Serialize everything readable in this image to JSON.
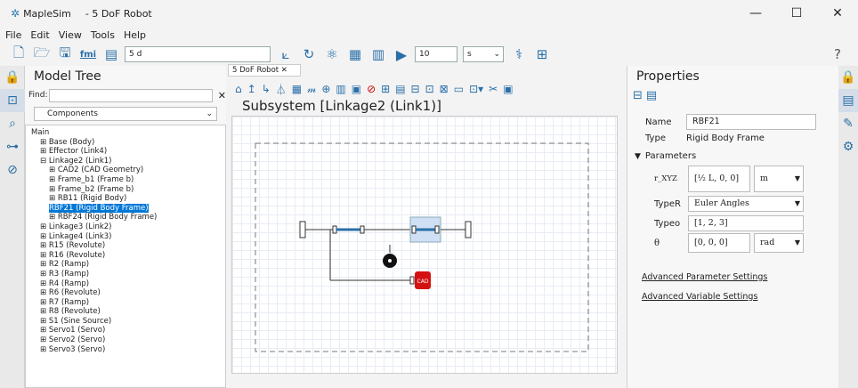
{
  "app": {
    "name": "MapleSim",
    "document": "- 5 DoF Robot"
  },
  "window_controls": {
    "minimize": "—",
    "maximize": "☐",
    "close": "✕"
  },
  "menu": [
    "File",
    "Edit",
    "View",
    "Tools",
    "Help"
  ],
  "toolbar": {
    "search_value": "5 d",
    "sim_time": "10",
    "time_unit": "s"
  },
  "model_tree": {
    "title": "Model Tree",
    "find_label": "Find:",
    "filter": "Components",
    "items": [
      {
        "label": "Main",
        "indent": 0
      },
      {
        "label": "⊞ Base (Body)",
        "indent": 1
      },
      {
        "label": "⊞ Effector (Link4)",
        "indent": 1
      },
      {
        "label": "⊟ Linkage2 (Link1)",
        "indent": 1
      },
      {
        "label": "⊞ CAD2 (CAD Geometry)",
        "indent": 2
      },
      {
        "label": "⊞ Frame_b1 (Frame b)",
        "indent": 2
      },
      {
        "label": "⊞ Frame_b2 (Frame b)",
        "indent": 2
      },
      {
        "label": "⊞ RB11 (Rigid Body)",
        "indent": 2
      },
      {
        "label": "RBF21 (Rigid Body Frame)",
        "indent": 2,
        "selected": true
      },
      {
        "label": "⊞ RBF24 (Rigid Body Frame)",
        "indent": 2
      },
      {
        "label": "⊞ Linkage3 (Link2)",
        "indent": 1
      },
      {
        "label": "⊞ Linkage4 (Link3)",
        "indent": 1
      },
      {
        "label": "⊞ R15 (Revolute)",
        "indent": 1
      },
      {
        "label": "⊞ R16 (Revolute)",
        "indent": 1
      },
      {
        "label": "⊞ R2 (Ramp)",
        "indent": 1
      },
      {
        "label": "⊞ R3 (Ramp)",
        "indent": 1
      },
      {
        "label": "⊞ R4 (Ramp)",
        "indent": 1
      },
      {
        "label": "⊞ R6 (Revolute)",
        "indent": 1
      },
      {
        "label": "⊞ R7 (Ramp)",
        "indent": 1
      },
      {
        "label": "⊞ R8 (Revolute)",
        "indent": 1
      },
      {
        "label": "⊞ S1 (Sine Source)",
        "indent": 1
      },
      {
        "label": "⊞ Servo1 (Servo)",
        "indent": 1
      },
      {
        "label": "⊞ Servo2 (Servo)",
        "indent": 1
      },
      {
        "label": "⊞ Servo3 (Servo)",
        "indent": 1
      }
    ]
  },
  "editor": {
    "tab": "5 DoF Robot ✕",
    "subsystem_title": "Subsystem [Linkage2 (Link1)]",
    "cad_label": "CAD"
  },
  "properties": {
    "title": "Properties",
    "name_label": "Name",
    "name_value": "RBF21",
    "type_label": "Type",
    "type_value": "Rigid Body Frame",
    "parameters_label": "Parameters",
    "rxyz_label": "r_XYZ",
    "rxyz_value": "[½ L, 0, 0]",
    "rxyz_unit": "m",
    "typeR_label": "TypeR",
    "typeR_value": "Euler Angles",
    "typeo_label": "Typeo",
    "typeo_value": "[1, 2, 3]",
    "theta_label": "θ",
    "theta_value": "[0, 0, 0]",
    "theta_unit": "rad",
    "link_advanced_params": "Advanced Parameter Settings",
    "link_advanced_vars": "Advanced Variable Settings"
  }
}
